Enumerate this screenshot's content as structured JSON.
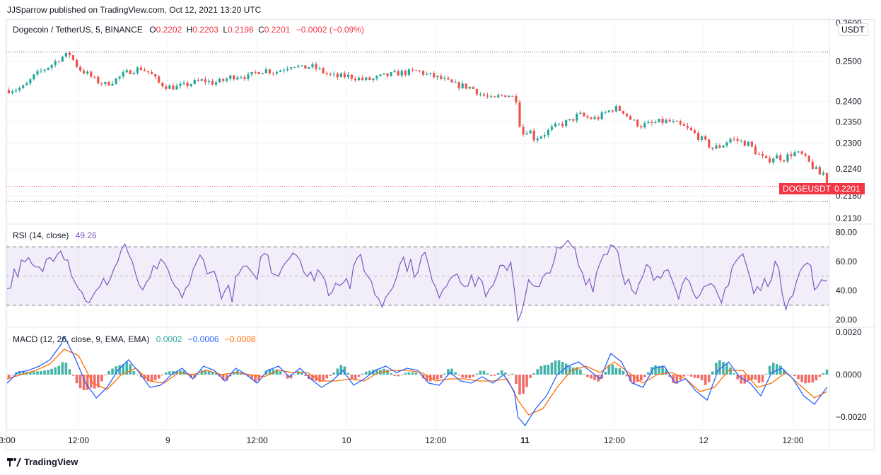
{
  "header": {
    "publisher_line": "JJSparrow published on TradingView.com, Oct 12, 2021 13:20 UTC"
  },
  "price_legend": {
    "symbol": "Dogecoin / TetherUS, 5, BINANCE",
    "o_label": "O",
    "o_value": "0.2202",
    "h_label": "H",
    "h_value": "0.2203",
    "l_label": "L",
    "l_value": "0.2198",
    "c_label": "C",
    "c_value": "0.2201",
    "change": "−0.0002 (−0.09%)",
    "currency_button": "USDT"
  },
  "rsi_legend": {
    "name": "RSI (14, close)",
    "value": "49.26"
  },
  "macd_legend": {
    "name": "MACD (12, 26, close, 9, EMA, EMA)",
    "hist_value": "0.0002",
    "macd_value": "−0.0006",
    "signal_value": "−0.0008"
  },
  "price_badge": {
    "ticker": "DOGEUSDT",
    "price": "0.2201"
  },
  "colors": {
    "up": "#26a69a",
    "down": "#ef5350",
    "rsi": "#7e57c2",
    "macd": "#2962ff",
    "signal": "#ff6d00",
    "grid": "#f0f3fa",
    "axis_text": "#131722"
  },
  "footer": {
    "brand": "TradingView",
    "logo_icon": "tradingview-logo-icon"
  },
  "chart_data": [
    {
      "type": "candlestick",
      "title": "Dogecoin / TetherUS, 5, BINANCE",
      "y_ticks": [
        "0.2600",
        "0.2500",
        "0.2400",
        "0.2350",
        "0.2300",
        "0.2240",
        "0.2180",
        "0.2130"
      ],
      "y_scale": "log",
      "ylim": [
        0.2118,
        0.2608
      ],
      "x_ticks": [
        "3:00",
        "12:00",
        "9",
        "12:00",
        "10",
        "12:00",
        "11",
        "12:00",
        "12",
        "12:00"
      ],
      "reference_lines": {
        "high": 0.2524,
        "last": 0.2201,
        "low": 0.2167
      },
      "close_path": [
        [
          0,
          0.2428
        ],
        [
          2.5,
          0.243
        ],
        [
          5,
          0.2436
        ],
        [
          7.5,
          0.2462
        ],
        [
          10,
          0.2478
        ],
        [
          12.5,
          0.2492
        ],
        [
          15,
          0.251
        ],
        [
          17.5,
          0.2518
        ],
        [
          20,
          0.2482
        ],
        [
          22.5,
          0.2468
        ],
        [
          25,
          0.245
        ],
        [
          27.5,
          0.2442
        ],
        [
          30,
          0.2452
        ],
        [
          32.5,
          0.2466
        ],
        [
          35,
          0.2478
        ],
        [
          37.5,
          0.2482
        ],
        [
          40,
          0.247
        ],
        [
          42.5,
          0.2445
        ],
        [
          45,
          0.2436
        ],
        [
          47.5,
          0.2435
        ],
        [
          50,
          0.244
        ],
        [
          52.5,
          0.2447
        ],
        [
          55,
          0.2452
        ],
        [
          57.5,
          0.2446
        ],
        [
          60,
          0.2449
        ],
        [
          62.5,
          0.246
        ],
        [
          65,
          0.2465
        ],
        [
          67.5,
          0.246
        ],
        [
          70,
          0.2474
        ],
        [
          72.5,
          0.2478
        ],
        [
          75,
          0.2472
        ],
        [
          77.5,
          0.2482
        ],
        [
          80,
          0.2493
        ],
        [
          82.5,
          0.2482
        ],
        [
          85,
          0.2488
        ],
        [
          87.5,
          0.2478
        ],
        [
          90,
          0.2465
        ],
        [
          92.5,
          0.2461
        ],
        [
          95,
          0.2463
        ],
        [
          97.5,
          0.2459
        ],
        [
          100,
          0.2453
        ],
        [
          102.5,
          0.2455
        ],
        [
          105,
          0.2462
        ],
        [
          107.5,
          0.2466
        ],
        [
          110,
          0.2471
        ],
        [
          112.5,
          0.2472
        ],
        [
          115,
          0.2476
        ],
        [
          117.5,
          0.2466
        ],
        [
          120,
          0.246
        ],
        [
          122.5,
          0.2452
        ],
        [
          125,
          0.2441
        ],
        [
          127.5,
          0.2438
        ],
        [
          130,
          0.2434
        ],
        [
          132.5,
          0.2418
        ],
        [
          135,
          0.2408
        ],
        [
          136,
          0.2402
        ],
        [
          137.5,
          0.2412
        ],
        [
          140,
          0.2418
        ],
        [
          142.5,
          0.2406
        ],
        [
          143.5,
          0.2346
        ],
        [
          144.5,
          0.2322
        ],
        [
          146,
          0.2335
        ],
        [
          147.5,
          0.2312
        ],
        [
          150,
          0.232
        ],
        [
          152.5,
          0.2334
        ],
        [
          155,
          0.2345
        ],
        [
          157.5,
          0.2352
        ],
        [
          160,
          0.2368
        ],
        [
          162.5,
          0.236
        ],
        [
          165,
          0.2358
        ],
        [
          167.5,
          0.2372
        ],
        [
          170,
          0.2384
        ],
        [
          172.5,
          0.2376
        ],
        [
          175,
          0.2352
        ],
        [
          177.5,
          0.2342
        ],
        [
          180,
          0.2345
        ],
        [
          182.5,
          0.235
        ],
        [
          185,
          0.2352
        ],
        [
          187.5,
          0.2345
        ],
        [
          190,
          0.2336
        ],
        [
          192.5,
          0.2322
        ],
        [
          195,
          0.2305
        ],
        [
          197.5,
          0.2288
        ],
        [
          200,
          0.2294
        ],
        [
          202.5,
          0.231
        ],
        [
          205,
          0.2305
        ],
        [
          207.5,
          0.2298
        ],
        [
          210,
          0.2276
        ],
        [
          212.5,
          0.2258
        ],
        [
          215,
          0.227
        ],
        [
          217.5,
          0.2264
        ],
        [
          220,
          0.2278
        ],
        [
          222.5,
          0.2272
        ],
        [
          225,
          0.225
        ],
        [
          227.5,
          0.2228
        ],
        [
          229,
          0.2232
        ],
        [
          229.5,
          0.2201
        ]
      ]
    },
    {
      "type": "line",
      "title": "RSI (14, close)",
      "y_ticks": [
        "80.00",
        "60.00",
        "40.00",
        "20.00"
      ],
      "ylim": [
        15,
        85
      ],
      "bands": {
        "upper": 70,
        "middle": 50,
        "lower": 30
      },
      "series": [
        {
          "name": "RSI (14, close)",
          "last": 49.26
        }
      ],
      "path": [
        [
          0,
          42
        ],
        [
          3,
          55
        ],
        [
          6,
          58
        ],
        [
          9,
          52
        ],
        [
          12,
          63
        ],
        [
          15,
          72
        ],
        [
          18,
          55
        ],
        [
          21,
          37
        ],
        [
          24,
          34
        ],
        [
          27,
          44
        ],
        [
          30,
          55
        ],
        [
          33,
          73
        ],
        [
          36,
          47
        ],
        [
          39,
          40
        ],
        [
          42,
          58
        ],
        [
          45,
          52
        ],
        [
          48,
          36
        ],
        [
          51,
          45
        ],
        [
          54,
          62
        ],
        [
          57,
          55
        ],
        [
          60,
          40
        ],
        [
          63,
          38
        ],
        [
          66,
          56
        ],
        [
          69,
          46
        ],
        [
          72,
          67
        ],
        [
          75,
          52
        ],
        [
          78,
          61
        ],
        [
          81,
          70
        ],
        [
          84,
          46
        ],
        [
          87,
          55
        ],
        [
          90,
          41
        ],
        [
          93,
          49
        ],
        [
          96,
          45
        ],
        [
          99,
          64
        ],
        [
          102,
          44
        ],
        [
          105,
          31
        ],
        [
          108,
          48
        ],
        [
          111,
          61
        ],
        [
          114,
          54
        ],
        [
          117,
          64
        ],
        [
          120,
          37
        ],
        [
          123,
          47
        ],
        [
          126,
          55
        ],
        [
          129,
          43
        ],
        [
          132,
          49
        ],
        [
          135,
          36
        ],
        [
          138,
          52
        ],
        [
          141,
          61
        ],
        [
          143,
          22
        ],
        [
          146,
          44
        ],
        [
          149,
          39
        ],
        [
          152,
          58
        ],
        [
          155,
          67
        ],
        [
          158,
          72
        ],
        [
          161,
          52
        ],
        [
          164,
          45
        ],
        [
          167,
          66
        ],
        [
          170,
          74
        ],
        [
          173,
          50
        ],
        [
          176,
          34
        ],
        [
          179,
          55
        ],
        [
          182,
          45
        ],
        [
          185,
          60
        ],
        [
          188,
          40
        ],
        [
          191,
          50
        ],
        [
          194,
          35
        ],
        [
          197,
          41
        ],
        [
          200,
          31
        ],
        [
          203,
          58
        ],
        [
          206,
          65
        ],
        [
          209,
          38
        ],
        [
          212,
          44
        ],
        [
          215,
          58
        ],
        [
          218,
          33
        ],
        [
          221,
          47
        ],
        [
          224,
          60
        ],
        [
          227,
          39
        ],
        [
          229.5,
          49.26
        ]
      ]
    },
    {
      "type": "line",
      "title": "MACD (12, 26, close, 9, EMA, EMA)",
      "y_ticks": [
        "0.0020",
        "0.0000",
        "−0.0020"
      ],
      "ylim": [
        -0.0026,
        0.0022
      ],
      "series": [
        {
          "name": "MACD",
          "last": -0.0006
        },
        {
          "name": "Signal",
          "last": -0.0008
        },
        {
          "name": "Histogram",
          "last": 0.0002
        }
      ],
      "macd_path": [
        [
          0,
          -0.0004
        ],
        [
          3,
          0.0001
        ],
        [
          6,
          0.0002
        ],
        [
          9,
          0.0004
        ],
        [
          12,
          0.0007
        ],
        [
          15,
          0.0014
        ],
        [
          16,
          0.0018
        ],
        [
          19,
          0.0008
        ],
        [
          22,
          -0.0004
        ],
        [
          25,
          -0.0011
        ],
        [
          28,
          -0.0006
        ],
        [
          31,
          0.0002
        ],
        [
          34,
          0.0007
        ],
        [
          37,
          0.0001
        ],
        [
          40,
          -0.0006
        ],
        [
          43,
          -0.0005
        ],
        [
          46,
          0.0
        ],
        [
          49,
          0.0003
        ],
        [
          52,
          -0.0002
        ],
        [
          55,
          0.0004
        ],
        [
          58,
          0.0002
        ],
        [
          61,
          -0.0003
        ],
        [
          64,
          0.0003
        ],
        [
          67,
          0.0
        ],
        [
          70,
          -0.0004
        ],
        [
          73,
          0.0002
        ],
        [
          76,
          0.0004
        ],
        [
          79,
          -0.0001
        ],
        [
          82,
          0.0003
        ],
        [
          85,
          -0.0002
        ],
        [
          88,
          -0.0006
        ],
        [
          91,
          -0.0003
        ],
        [
          94,
          0.0002
        ],
        [
          97,
          -0.0005
        ],
        [
          100,
          -0.0002
        ],
        [
          103,
          0.0002
        ],
        [
          106,
          0.0004
        ],
        [
          109,
          0.0001
        ],
        [
          112,
          0.0003
        ],
        [
          115,
          0.0002
        ],
        [
          118,
          -0.0004
        ],
        [
          121,
          -0.0005
        ],
        [
          124,
          0.0001
        ],
        [
          127,
          -0.0003
        ],
        [
          130,
          -0.0004
        ],
        [
          133,
          -0.0001
        ],
        [
          136,
          -0.0004
        ],
        [
          139,
          0.0
        ],
        [
          142,
          -0.0008
        ],
        [
          143,
          -0.002
        ],
        [
          145,
          -0.0024
        ],
        [
          148,
          -0.0016
        ],
        [
          151,
          -0.001
        ],
        [
          154,
          0.0
        ],
        [
          157,
          0.0004
        ],
        [
          160,
          0.0006
        ],
        [
          163,
          0.0002
        ],
        [
          166,
          -0.0002
        ],
        [
          169,
          0.001
        ],
        [
          172,
          0.0006
        ],
        [
          175,
          -0.0004
        ],
        [
          178,
          -0.0006
        ],
        [
          181,
          0.0003
        ],
        [
          184,
          0.0004
        ],
        [
          187,
          -0.0004
        ],
        [
          190,
          -0.0002
        ],
        [
          193,
          -0.0008
        ],
        [
          196,
          -0.0012
        ],
        [
          199,
          0.0002
        ],
        [
          202,
          0.0006
        ],
        [
          205,
          -0.0001
        ],
        [
          208,
          -0.0004
        ],
        [
          211,
          -0.001
        ],
        [
          214,
          0.0001
        ],
        [
          217,
          0.0003
        ],
        [
          220,
          -0.0002
        ],
        [
          223,
          -0.001
        ],
        [
          226,
          -0.0014
        ],
        [
          229.5,
          -0.0006
        ]
      ],
      "signal_path": [
        [
          0,
          -0.0002
        ],
        [
          4,
          0.0
        ],
        [
          8,
          0.0002
        ],
        [
          12,
          0.0005
        ],
        [
          16,
          0.0012
        ],
        [
          20,
          0.0009
        ],
        [
          24,
          -0.0004
        ],
        [
          28,
          -0.0007
        ],
        [
          32,
          0.0
        ],
        [
          36,
          0.0003
        ],
        [
          40,
          -0.0003
        ],
        [
          44,
          -0.0004
        ],
        [
          48,
          0.0001
        ],
        [
          52,
          0.0
        ],
        [
          56,
          0.0002
        ],
        [
          60,
          0.0
        ],
        [
          64,
          0.0001
        ],
        [
          68,
          0.0
        ],
        [
          72,
          -0.0001
        ],
        [
          76,
          0.0002
        ],
        [
          80,
          0.0001
        ],
        [
          84,
          0.0001
        ],
        [
          88,
          -0.0003
        ],
        [
          92,
          -0.0003
        ],
        [
          96,
          -0.0002
        ],
        [
          100,
          -0.0003
        ],
        [
          104,
          0.0001
        ],
        [
          108,
          0.0002
        ],
        [
          112,
          0.0002
        ],
        [
          116,
          0.0001
        ],
        [
          120,
          -0.0003
        ],
        [
          124,
          -0.0002
        ],
        [
          128,
          -0.0002
        ],
        [
          132,
          -0.0003
        ],
        [
          136,
          -0.0003
        ],
        [
          140,
          -0.0002
        ],
        [
          143,
          -0.0012
        ],
        [
          146,
          -0.0019
        ],
        [
          150,
          -0.0016
        ],
        [
          154,
          -0.0006
        ],
        [
          158,
          0.0002
        ],
        [
          162,
          0.0004
        ],
        [
          166,
          0.0001
        ],
        [
          170,
          0.0006
        ],
        [
          174,
          0.0001
        ],
        [
          178,
          -0.0004
        ],
        [
          182,
          0.0
        ],
        [
          186,
          0.0001
        ],
        [
          190,
          -0.0002
        ],
        [
          194,
          -0.0008
        ],
        [
          198,
          -0.0006
        ],
        [
          202,
          0.0002
        ],
        [
          206,
          0.0002
        ],
        [
          210,
          -0.0006
        ],
        [
          214,
          -0.0004
        ],
        [
          218,
          0.0001
        ],
        [
          222,
          -0.0005
        ],
        [
          226,
          -0.0011
        ],
        [
          229.5,
          -0.0008
        ]
      ]
    }
  ]
}
